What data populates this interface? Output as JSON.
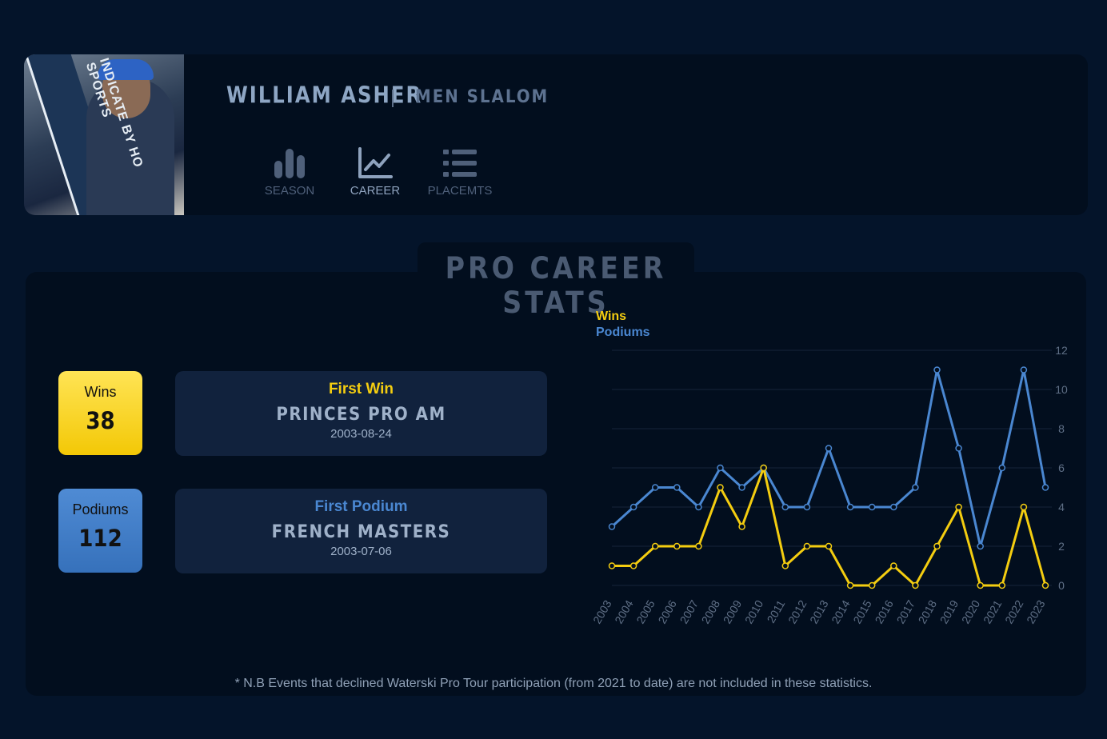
{
  "athlete": {
    "name": "WILLIAM ASHER",
    "discipline": "MEN SLALOM",
    "photo_text": "INDICATE BY HO SPORTS"
  },
  "tabs": [
    {
      "label": "SEASON",
      "icon": "bar-chart-icon",
      "active": false
    },
    {
      "label": "CAREER",
      "icon": "line-chart-icon",
      "active": true
    },
    {
      "label": "PLACEMTS",
      "icon": "list-icon",
      "active": false
    }
  ],
  "stats": {
    "title": "PRO CAREER STATS",
    "wins": {
      "label": "Wins",
      "value": "38"
    },
    "podiums": {
      "label": "Podiums",
      "value": "112"
    },
    "first_win": {
      "label": "First Win",
      "event": "PRINCES PRO AM",
      "date": "2003-08-24"
    },
    "first_podium": {
      "label": "First Podium",
      "event": "FRENCH MASTERS",
      "date": "2003-07-06"
    }
  },
  "colors": {
    "wins": "#f4cd10",
    "podiums": "#4a87d1",
    "background": "#04142a",
    "card": "#020e1e"
  },
  "chart_data": {
    "type": "line",
    "x": [
      "2003",
      "2004",
      "2005",
      "2006",
      "2007",
      "2008",
      "2009",
      "2010",
      "2011",
      "2012",
      "2013",
      "2014",
      "2015",
      "2016",
      "2017",
      "2018",
      "2019",
      "2020",
      "2021",
      "2022",
      "2023"
    ],
    "series": [
      {
        "name": "Wins",
        "color": "#f4cd10",
        "values": [
          1,
          1,
          2,
          2,
          2,
          5,
          3,
          6,
          1,
          2,
          2,
          0,
          0,
          1,
          0,
          2,
          4,
          0,
          0,
          4,
          0
        ]
      },
      {
        "name": "Podiums",
        "color": "#4a87d1",
        "values": [
          3,
          4,
          5,
          5,
          4,
          6,
          5,
          6,
          4,
          4,
          7,
          4,
          4,
          4,
          5,
          11,
          7,
          2,
          6,
          11,
          5
        ]
      }
    ],
    "ylim": [
      0,
      12
    ],
    "yticks": [
      0,
      2,
      4,
      6,
      8,
      10,
      12
    ],
    "y_axis_side": "right",
    "grid": true,
    "legend": "top-left"
  },
  "footnote": "* N.B Events that declined Waterski Pro Tour participation (from 2021 to date) are not included in these statistics."
}
